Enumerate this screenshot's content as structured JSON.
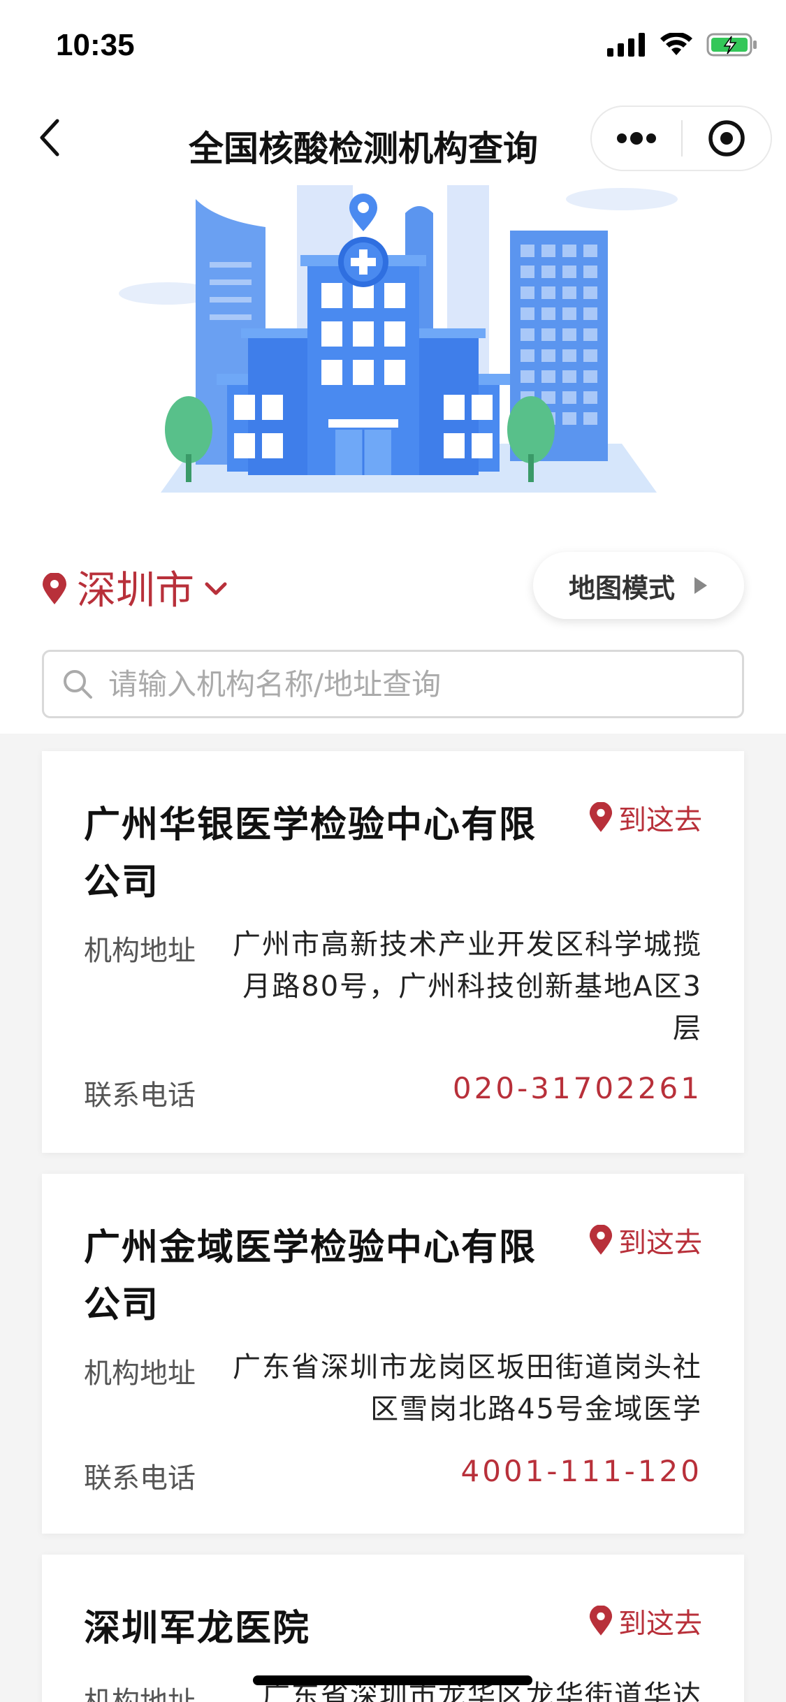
{
  "status_bar": {
    "time": "10:35"
  },
  "nav": {
    "title": "全国核酸检测机构查询"
  },
  "city": {
    "name": "深圳市"
  },
  "map_mode": {
    "label": "地图模式"
  },
  "search": {
    "placeholder": "请输入机构名称/地址查询"
  },
  "labels": {
    "address": "机构地址",
    "phone": "联系电话",
    "go": "到这去"
  },
  "institutions": [
    {
      "name": "广州华银医学检验中心有限公司",
      "address": "广州市高新技术产业开发区科学城揽月路80号，广州科技创新基地A区3层",
      "phone": "020-31702261"
    },
    {
      "name": "广州金域医学检验中心有限公司",
      "address": "广东省深圳市龙岗区坂田街道岗头社区雪岗北路45号金域医学",
      "phone": "4001-111-120"
    },
    {
      "name": "深圳军龙医院",
      "address": "广东省深圳市龙华区龙华街道华达"
    }
  ],
  "colors": {
    "accent": "#b8303a",
    "banner_blue": "#4a8af0"
  }
}
